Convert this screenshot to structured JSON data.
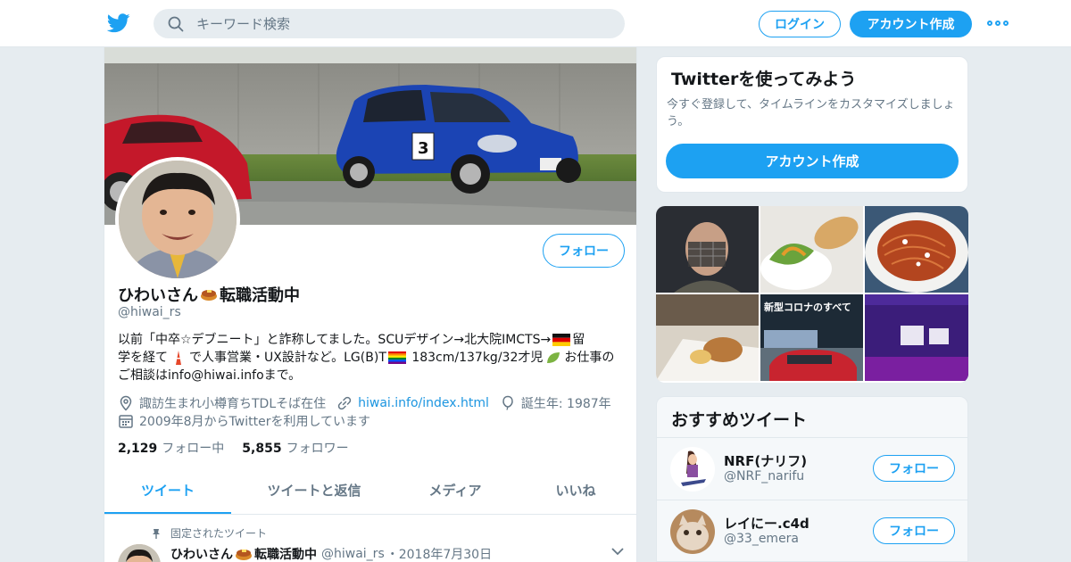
{
  "header": {
    "search_placeholder": "キーワード検索",
    "login_label": "ログイン",
    "signup_label": "アカウント作成"
  },
  "profile": {
    "follow_label": "フォロー",
    "name": "ひわいさん",
    "name_suffix": "転職活動中",
    "handle": "@hiwai_rs",
    "bio_line1": "以前「中卒☆デブニート」と詐称してました。SCUデザイン→北大院IMCTS→",
    "bio_line1_end": "留",
    "bio_line2_a": "学を経て",
    "bio_line2_b": "で人事営業・UX設計など。LG(B)T",
    "bio_line2_c": " 183cm/137kg/32才児",
    "bio_line2_d": "お仕事の",
    "bio_line3": "ご相談はinfo@hiwai.infoまで。",
    "location": "諏訪生まれ小樽育ちTDLそば在住",
    "url": "hiwai.info/index.html",
    "birth": "誕生年: 1987年",
    "joined": "2009年8月からTwitterを利用しています",
    "following_count": "2,129",
    "following_label": "フォロー中",
    "followers_count": "5,855",
    "followers_label": "フォロワー"
  },
  "tabs": [
    {
      "label": "ツイート",
      "active": true
    },
    {
      "label": "ツイートと返信",
      "active": false
    },
    {
      "label": "メディア",
      "active": false
    },
    {
      "label": "いいね",
      "active": false
    }
  ],
  "pinned_tweet": {
    "pinned_label": "固定されたツイート",
    "name": "ひわいさん",
    "name_suffix": "転職活動中",
    "handle": "@hiwai_rs",
    "date": "・2018年7月30日"
  },
  "signup_card": {
    "title": "Twitterを使ってみよう",
    "text": "今すぐ登録して、タイムラインをカスタマイズしましょう。",
    "button_label": "アカウント作成"
  },
  "recommend": {
    "title": "おすすめツイート",
    "accounts": [
      {
        "name": "NRF(ナリフ)",
        "handle": "@NRF_narifu",
        "follow_label": "フォロー"
      },
      {
        "name": "レイにー.c4d",
        "handle": "@33_emera",
        "follow_label": "フォロー"
      }
    ]
  },
  "media_thumbs": {
    "corona_title": "新型コロナのすべて"
  },
  "colors": {
    "accent": "#1da1f2",
    "background": "#e6ecf0",
    "secondary_text": "#657786"
  }
}
